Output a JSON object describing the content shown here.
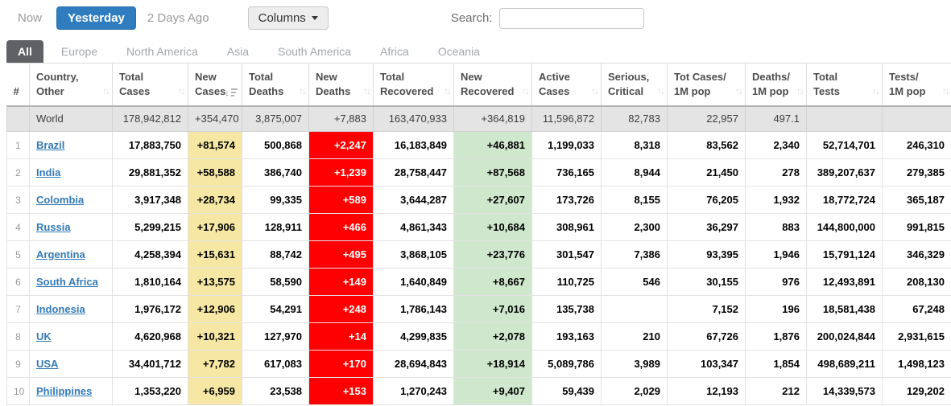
{
  "toolbar": {
    "now_label": "Now",
    "yesterday_label": "Yesterday",
    "two_days_ago_label": "2 Days Ago",
    "columns_label": "Columns",
    "search_label": "Search:",
    "search_value": ""
  },
  "tabs": [
    {
      "label": "All",
      "active": true
    },
    {
      "label": "Europe",
      "active": false
    },
    {
      "label": "North America",
      "active": false
    },
    {
      "label": "Asia",
      "active": false
    },
    {
      "label": "South America",
      "active": false
    },
    {
      "label": "Africa",
      "active": false
    },
    {
      "label": "Oceania",
      "active": false
    }
  ],
  "table": {
    "headers": [
      {
        "line1": "#",
        "line2": "",
        "sort": null
      },
      {
        "line1": "Country,",
        "line2": "Other",
        "sort": "unsorted"
      },
      {
        "line1": "Total",
        "line2": "Cases",
        "sort": "unsorted"
      },
      {
        "line1": "New",
        "line2": "Cases",
        "sort": "desc"
      },
      {
        "line1": "Total",
        "line2": "Deaths",
        "sort": "unsorted"
      },
      {
        "line1": "New",
        "line2": "Deaths",
        "sort": "unsorted"
      },
      {
        "line1": "Total",
        "line2": "Recovered",
        "sort": "unsorted"
      },
      {
        "line1": "New",
        "line2": "Recovered",
        "sort": "unsorted"
      },
      {
        "line1": "Active",
        "line2": "Cases",
        "sort": "unsorted"
      },
      {
        "line1": "Serious,",
        "line2": "Critical",
        "sort": "unsorted"
      },
      {
        "line1": "Tot Cases/",
        "line2": "1M pop",
        "sort": "unsorted"
      },
      {
        "line1": "Deaths/",
        "line2": "1M pop",
        "sort": "unsorted"
      },
      {
        "line1": "Total",
        "line2": "Tests",
        "sort": "unsorted"
      },
      {
        "line1": "Tests/",
        "line2": "1M pop",
        "sort": "unsorted"
      }
    ],
    "world_row": {
      "rank": "",
      "country": "World",
      "total_cases": "178,942,812",
      "new_cases": "+354,470",
      "total_deaths": "3,875,007",
      "new_deaths": "+7,883",
      "total_recovered": "163,470,933",
      "new_recovered": "+364,819",
      "active_cases": "11,596,872",
      "serious_critical": "82,783",
      "tot_cases_1m": "22,957",
      "deaths_1m": "497.1",
      "total_tests": "",
      "tests_1m": ""
    },
    "rows": [
      {
        "rank": "1",
        "country": "Brazil",
        "total_cases": "17,883,750",
        "new_cases": "+81,574",
        "total_deaths": "500,868",
        "new_deaths": "+2,247",
        "total_recovered": "16,183,849",
        "new_recovered": "+46,881",
        "active_cases": "1,199,033",
        "serious_critical": "8,318",
        "tot_cases_1m": "83,562",
        "deaths_1m": "2,340",
        "total_tests": "52,714,701",
        "tests_1m": "246,310"
      },
      {
        "rank": "2",
        "country": "India",
        "total_cases": "29,881,352",
        "new_cases": "+58,588",
        "total_deaths": "386,740",
        "new_deaths": "+1,239",
        "total_recovered": "28,758,447",
        "new_recovered": "+87,568",
        "active_cases": "736,165",
        "serious_critical": "8,944",
        "tot_cases_1m": "21,450",
        "deaths_1m": "278",
        "total_tests": "389,207,637",
        "tests_1m": "279,385"
      },
      {
        "rank": "3",
        "country": "Colombia",
        "total_cases": "3,917,348",
        "new_cases": "+28,734",
        "total_deaths": "99,335",
        "new_deaths": "+589",
        "total_recovered": "3,644,287",
        "new_recovered": "+27,607",
        "active_cases": "173,726",
        "serious_critical": "8,155",
        "tot_cases_1m": "76,205",
        "deaths_1m": "1,932",
        "total_tests": "18,772,724",
        "tests_1m": "365,187"
      },
      {
        "rank": "4",
        "country": "Russia",
        "total_cases": "5,299,215",
        "new_cases": "+17,906",
        "total_deaths": "128,911",
        "new_deaths": "+466",
        "total_recovered": "4,861,343",
        "new_recovered": "+10,684",
        "active_cases": "308,961",
        "serious_critical": "2,300",
        "tot_cases_1m": "36,297",
        "deaths_1m": "883",
        "total_tests": "144,800,000",
        "tests_1m": "991,815"
      },
      {
        "rank": "5",
        "country": "Argentina",
        "total_cases": "4,258,394",
        "new_cases": "+15,631",
        "total_deaths": "88,742",
        "new_deaths": "+495",
        "total_recovered": "3,868,105",
        "new_recovered": "+23,776",
        "active_cases": "301,547",
        "serious_critical": "7,386",
        "tot_cases_1m": "93,395",
        "deaths_1m": "1,946",
        "total_tests": "15,791,124",
        "tests_1m": "346,329"
      },
      {
        "rank": "6",
        "country": "South Africa",
        "total_cases": "1,810,164",
        "new_cases": "+13,575",
        "total_deaths": "58,590",
        "new_deaths": "+149",
        "total_recovered": "1,640,849",
        "new_recovered": "+8,667",
        "active_cases": "110,725",
        "serious_critical": "546",
        "tot_cases_1m": "30,155",
        "deaths_1m": "976",
        "total_tests": "12,493,891",
        "tests_1m": "208,130"
      },
      {
        "rank": "7",
        "country": "Indonesia",
        "total_cases": "1,976,172",
        "new_cases": "+12,906",
        "total_deaths": "54,291",
        "new_deaths": "+248",
        "total_recovered": "1,786,143",
        "new_recovered": "+7,016",
        "active_cases": "135,738",
        "serious_critical": "",
        "tot_cases_1m": "7,152",
        "deaths_1m": "196",
        "total_tests": "18,581,438",
        "tests_1m": "67,248"
      },
      {
        "rank": "8",
        "country": "UK",
        "total_cases": "4,620,968",
        "new_cases": "+10,321",
        "total_deaths": "127,970",
        "new_deaths": "+14",
        "total_recovered": "4,299,835",
        "new_recovered": "+2,078",
        "active_cases": "193,163",
        "serious_critical": "210",
        "tot_cases_1m": "67,726",
        "deaths_1m": "1,876",
        "total_tests": "200,024,844",
        "tests_1m": "2,931,615"
      },
      {
        "rank": "9",
        "country": "USA",
        "total_cases": "34,401,712",
        "new_cases": "+7,782",
        "total_deaths": "617,083",
        "new_deaths": "+170",
        "total_recovered": "28,694,843",
        "new_recovered": "+18,914",
        "active_cases": "5,089,786",
        "serious_critical": "3,989",
        "tot_cases_1m": "103,347",
        "deaths_1m": "1,854",
        "total_tests": "498,689,211",
        "tests_1m": "1,498,123"
      },
      {
        "rank": "10",
        "country": "Philippines",
        "total_cases": "1,353,220",
        "new_cases": "+6,959",
        "total_deaths": "23,538",
        "new_deaths": "+153",
        "total_recovered": "1,270,243",
        "new_recovered": "+9,407",
        "active_cases": "59,439",
        "serious_critical": "2,029",
        "tot_cases_1m": "12,193",
        "deaths_1m": "212",
        "total_tests": "14,339,573",
        "tests_1m": "129,202"
      }
    ]
  },
  "colors": {
    "accent_blue": "#2f7cbe",
    "link_blue": "#337ab7",
    "selected_tab_bg": "#5f6164",
    "new_cases_bg": "#f6e8a4",
    "new_deaths_bg": "#ff0000",
    "new_recovered_bg": "#cfe8cd",
    "world_row_bg": "#e4e4e4"
  }
}
